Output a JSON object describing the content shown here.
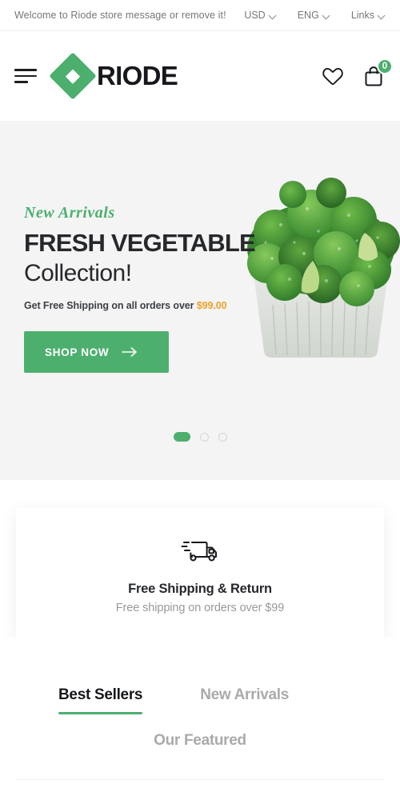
{
  "topbar": {
    "welcome": "Welcome to Riode store message or remove it!",
    "currency": "USD",
    "language": "ENG",
    "links": "Links",
    "chevron_icon": "chevron-down-icon"
  },
  "header": {
    "menu_icon": "hamburger-menu-icon",
    "logo_text": "RIODE",
    "logo_mark_icon": "riode-diamond-logo-icon",
    "wishlist_icon": "heart-icon",
    "cart_icon": "shopping-bag-icon",
    "cart_count": "0"
  },
  "hero": {
    "eyebrow": "New Arrivals",
    "title_line1": "FRESH VEGETABLE",
    "title_line2": "Collection!",
    "subtitle_prefix": "Get Free Shipping on all orders over ",
    "subtitle_price": "$99.00",
    "cta_label": "SHOP NOW",
    "cta_arrow_icon": "arrow-right-icon",
    "image_alt": "broccoli-tray-image",
    "slides": [
      {
        "label": "slide-1",
        "active": true
      },
      {
        "label": "slide-2",
        "active": false
      },
      {
        "label": "slide-3",
        "active": false
      }
    ]
  },
  "service": {
    "icon": "delivery-truck-icon",
    "title": "Free Shipping & Return",
    "description": "Free shipping on orders over $99"
  },
  "tabs": {
    "items": [
      {
        "label": "Best Sellers",
        "active": true
      },
      {
        "label": "New Arrivals",
        "active": false
      },
      {
        "label": "Our Featured",
        "active": false
      }
    ]
  },
  "colors": {
    "brand_green": "#4caf6e",
    "accent_orange": "#f0a029",
    "dark_text": "#26282c",
    "muted_text": "#999999",
    "hero_bg": "#f4f4f4"
  }
}
